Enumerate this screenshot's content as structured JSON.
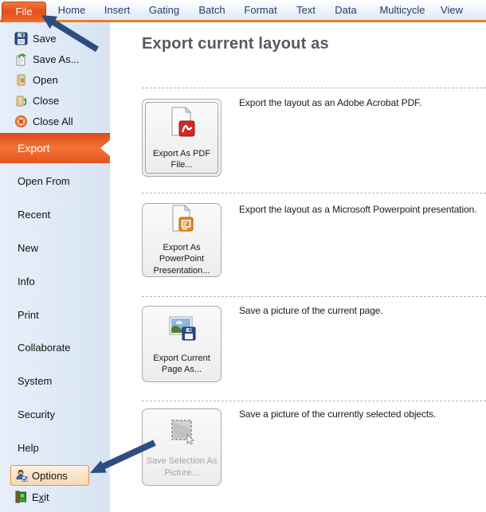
{
  "menu": {
    "active_tab": "File",
    "tabs": [
      {
        "label": "File"
      },
      {
        "label": "Home"
      },
      {
        "label": "Insert"
      },
      {
        "label": "Gating"
      },
      {
        "label": "Batch"
      },
      {
        "label": "Format"
      },
      {
        "label": "Text"
      },
      {
        "label": "Data"
      },
      {
        "label": "Multicycle"
      },
      {
        "label": "View"
      }
    ]
  },
  "sidebar": {
    "file_items": [
      {
        "label": "Save",
        "icon": "save-icon"
      },
      {
        "label": "Save As...",
        "icon": "save-as-icon"
      },
      {
        "label": "Open",
        "icon": "open-icon"
      },
      {
        "label": "Close",
        "icon": "close-icon"
      },
      {
        "label": "Close All",
        "icon": "close-all-icon"
      }
    ],
    "active_item": {
      "label": "Export"
    },
    "nav_items": [
      {
        "label": "Open From"
      },
      {
        "label": "Recent"
      },
      {
        "label": "New"
      },
      {
        "label": "Info"
      },
      {
        "label": "Print"
      },
      {
        "label": "Collaborate"
      },
      {
        "label": "System"
      },
      {
        "label": "Security"
      },
      {
        "label": "Help"
      }
    ],
    "options_label": "Options",
    "exit_label": {
      "pre": "E",
      "mnemonic": "x",
      "post": "it"
    }
  },
  "main": {
    "title": "Export current layout as",
    "sections": [
      {
        "button_label": "Export As PDF File...",
        "description": "Export the layout as an Adobe Acrobat PDF.",
        "icon": "pdf-file-icon",
        "state": "focused"
      },
      {
        "button_label": "Export As PowerPoint Presentation...",
        "description": "Export the layout as a Microsoft Powerpoint presentation.",
        "icon": "powerpoint-file-icon",
        "state": "normal"
      },
      {
        "button_label": "Export Current Page As...",
        "description": "Save a picture of the current page.",
        "icon": "picture-save-icon",
        "state": "normal"
      },
      {
        "button_label": "Save Selection As Picture...",
        "description": "Save a picture of the currently selected objects.",
        "icon": "selection-marquee-icon",
        "state": "disabled"
      }
    ]
  },
  "annotations": {
    "arrows": [
      {
        "target": "file-tab"
      },
      {
        "target": "options-item"
      }
    ]
  },
  "colors": {
    "accent_orange": "#e8511f",
    "menubar_rule_orange": "#ee7b23",
    "arrow_blue": "#2d4d80",
    "sidebar_blue": "#dde8f6",
    "heading_gray": "#595959",
    "pdf_red": "#cf2a27",
    "powerpoint_orange": "#e8861c"
  }
}
